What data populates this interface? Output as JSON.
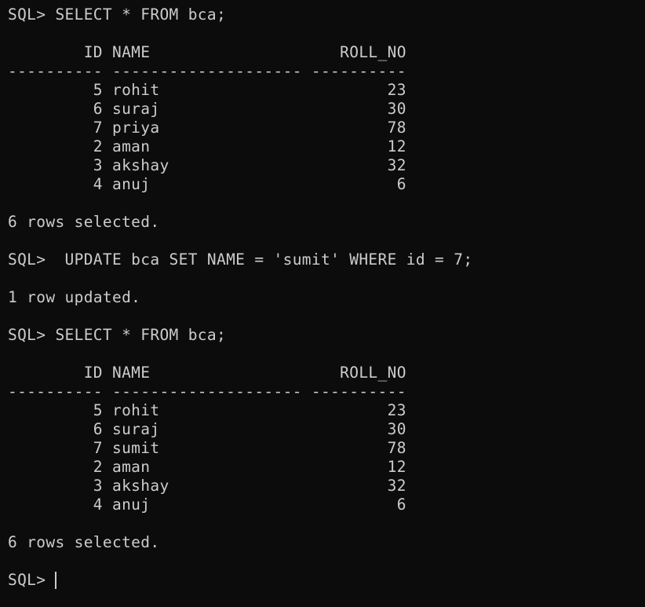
{
  "terminal": {
    "background": "#0c0c0c",
    "foreground": "#cccccc",
    "lines": [
      "SQL> SELECT * FROM bca;",
      "",
      "        ID NAME                    ROLL_NO",
      "---------- -------------------- ----------",
      "         5 rohit                        23",
      "         6 suraj                        30",
      "         7 priya                        78",
      "         2 aman                         12",
      "         3 akshay                       32",
      "         4 anuj                          6",
      "",
      "6 rows selected.",
      "",
      "SQL>  UPDATE bca SET NAME = 'sumit' WHERE id = 7;",
      "",
      "1 row updated.",
      "",
      "SQL> SELECT * FROM bca;",
      "",
      "        ID NAME                    ROLL_NO",
      "---------- -------------------- ----------",
      "         5 rohit                        23",
      "         6 suraj                        30",
      "         7 sumit                        78",
      "         2 aman                         12",
      "         3 akshay                       32",
      "         4 anuj                          6",
      "",
      "6 rows selected.",
      "",
      "SQL> "
    ]
  }
}
